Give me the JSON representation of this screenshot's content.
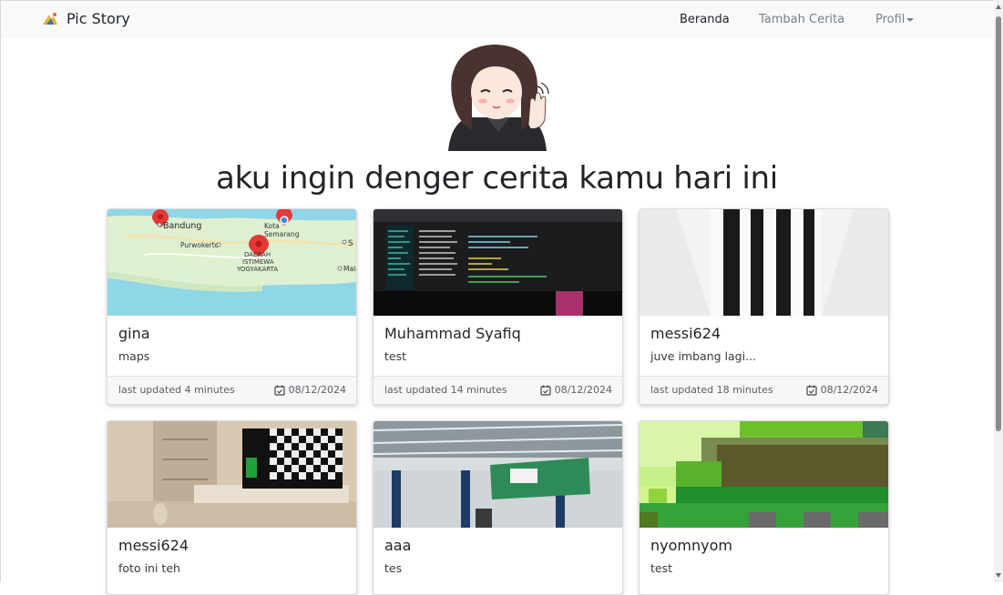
{
  "navbar": {
    "brand": "Pic Story",
    "links": {
      "home": "Beranda",
      "add_story": "Tambah Cerita",
      "profile": "Profil"
    }
  },
  "hero": {
    "headline": "aku ingin denger cerita kamu hari ini"
  },
  "cards": [
    {
      "title": "gina",
      "desc": "maps",
      "updated": "last updated 4 minutes",
      "date": "08/12/2024",
      "map_labels": {
        "bandung": "Bandung",
        "kota": "Kota",
        "semarang": "Semarang",
        "purwokerto": "Purwokerto",
        "daerah": "DAERAH",
        "istimewa": "ISTIMEWA",
        "yogyakarta": "YOGYAKARTA",
        "mala": "Mala",
        "s": "S"
      }
    },
    {
      "title": "Muhammad Syafiq",
      "desc": "test",
      "updated": "last updated 14 minutes",
      "date": "08/12/2024"
    },
    {
      "title": "messi624",
      "desc": "juve imbang lagi...",
      "updated": "last updated 18 minutes",
      "date": "08/12/2024"
    },
    {
      "title": "messi624",
      "desc": "foto ini teh"
    },
    {
      "title": "aaa",
      "desc": "tes"
    },
    {
      "title": "nyomnyom",
      "desc": "test"
    }
  ],
  "colors": {
    "navbar_bg": "#f8f9fa",
    "map_sea": "#8fd6e6",
    "map_land": "#dff0d0",
    "marker_red": "#e53935"
  }
}
